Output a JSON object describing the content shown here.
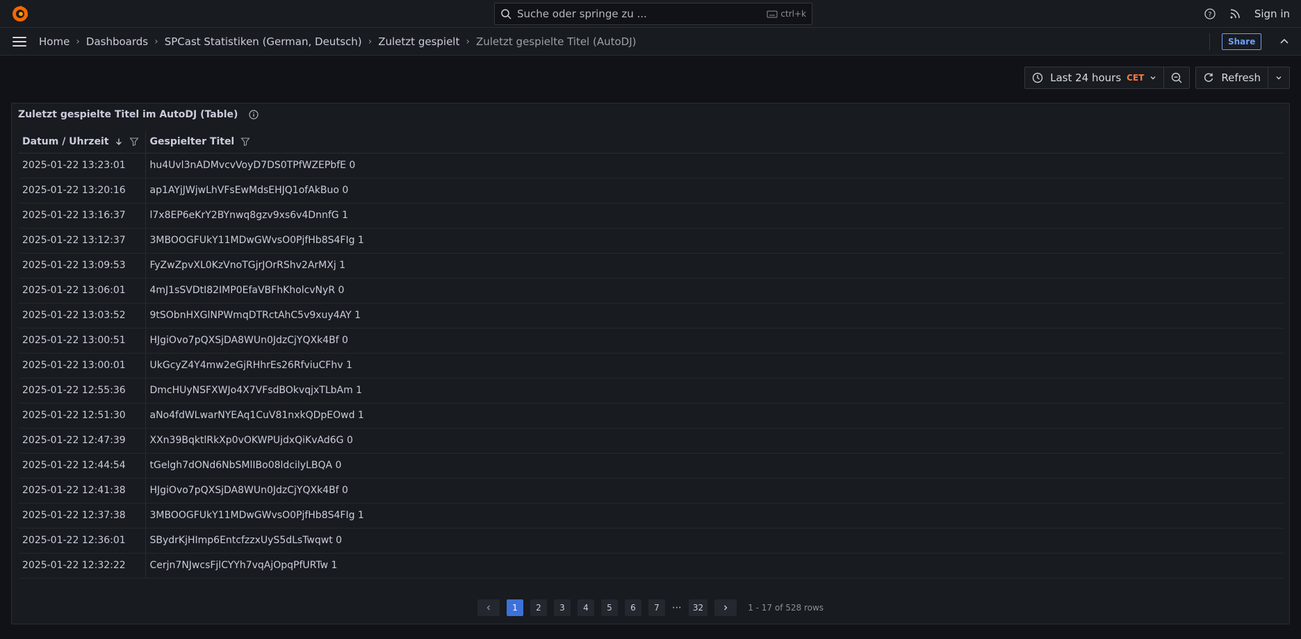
{
  "search": {
    "placeholder": "Suche oder springe zu ...",
    "shortcut": "ctrl+k"
  },
  "topbar": {
    "sign_in": "Sign in"
  },
  "breadcrumbs": [
    "Home",
    "Dashboards",
    "SPCast Statistiken (German, Deutsch)",
    "Zuletzt gespielt",
    "Zuletzt gespielte Titel (AutoDJ)"
  ],
  "nav": {
    "share": "Share"
  },
  "time_picker": {
    "range": "Last 24 hours",
    "timezone": "CET",
    "refresh": "Refresh"
  },
  "panel": {
    "title": "Zuletzt gespielte Titel im AutoDJ (Table)",
    "columns": [
      "Datum / Uhrzeit",
      "Gespielter Titel"
    ],
    "rows": [
      [
        "2025-01-22 13:23:01",
        "hu4Uvl3nADMvcvVoyD7DS0TPfWZEPbfE 0"
      ],
      [
        "2025-01-22 13:20:16",
        "ap1AYjJWjwLhVFsEwMdsEHJQ1ofAkBuo 0"
      ],
      [
        "2025-01-22 13:16:37",
        "l7x8EP6eKrY2BYnwq8gzv9xs6v4DnnfG 1"
      ],
      [
        "2025-01-22 13:12:37",
        "3MBOOGFUkY11MDwGWvsO0PjfHb8S4FIg 1"
      ],
      [
        "2025-01-22 13:09:53",
        "FyZwZpvXL0KzVnoTGjrJOrRShv2ArMXj 1"
      ],
      [
        "2025-01-22 13:06:01",
        "4mJ1sSVDtI82IMP0EfaVBFhKholcvNyR 0"
      ],
      [
        "2025-01-22 13:03:52",
        "9tSObnHXGlNPWmqDTRctAhC5v9xuy4AY 1"
      ],
      [
        "2025-01-22 13:00:51",
        "HJgiOvo7pQXSjDA8WUn0JdzCjYQXk4Bf 0"
      ],
      [
        "2025-01-22 13:00:01",
        "UkGcyZ4Y4mw2eGjRHhrEs26RfviuCFhv 1"
      ],
      [
        "2025-01-22 12:55:36",
        "DmcHUyNSFXWJo4X7VFsdBOkvqjxTLbAm 1"
      ],
      [
        "2025-01-22 12:51:30",
        "aNo4fdWLwarNYEAq1CuV81nxkQDpEOwd 1"
      ],
      [
        "2025-01-22 12:47:39",
        "XXn39BqktlRkXp0vOKWPUjdxQiKvAd6G 0"
      ],
      [
        "2025-01-22 12:44:54",
        "tGelgh7dONd6NbSMlIBo08ldcilyLBQA 0"
      ],
      [
        "2025-01-22 12:41:38",
        "HJgiOvo7pQXSjDA8WUn0JdzCjYQXk4Bf 0"
      ],
      [
        "2025-01-22 12:37:38",
        "3MBOOGFUkY11MDwGWvsO0PjfHb8S4FIg 1"
      ],
      [
        "2025-01-22 12:36:01",
        "SBydrKjHImp6EntcfzzxUyS5dLsTwqwt 0"
      ],
      [
        "2025-01-22 12:32:22",
        "Cerjn7NJwcsFjlCYYh7vqAjOpqPfURTw 1"
      ]
    ]
  },
  "pagination": {
    "pages": [
      "1",
      "2",
      "3",
      "4",
      "5",
      "6",
      "7"
    ],
    "ellipsis": "⋯",
    "last": "32",
    "active": "1",
    "rows_info": "1 - 17 of 528 rows"
  },
  "colors": {
    "accent": "#3d71d9",
    "timezone": "#ff7941",
    "logo": "#f46800"
  },
  "icons": [
    "grafana-logo-icon",
    "search-icon",
    "keyboard-icon",
    "help-icon",
    "rss-icon",
    "hamburger-icon",
    "chevron-right-icon",
    "chevron-up-icon",
    "clock-icon",
    "chevron-down-icon",
    "zoom-out-icon",
    "refresh-icon",
    "info-icon",
    "sort-desc-icon",
    "filter-icon",
    "chevron-left-icon"
  ]
}
